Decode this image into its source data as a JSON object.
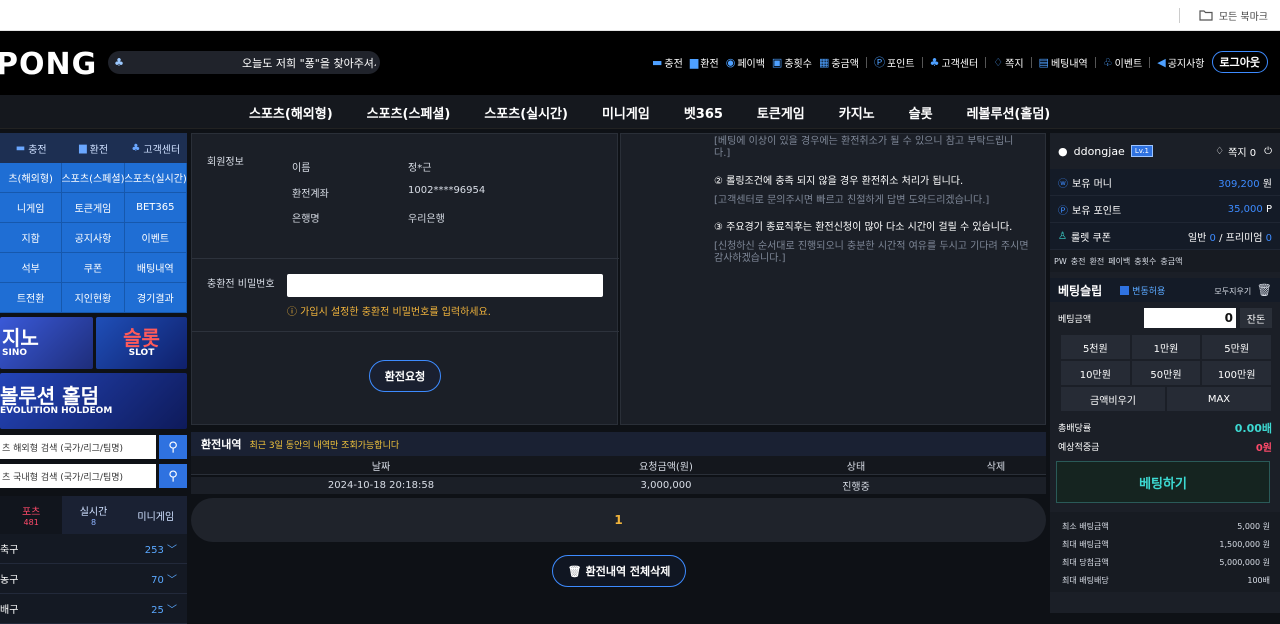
{
  "bookmarks": {
    "label": "모든 북마크"
  },
  "header": {
    "logo": "PONG",
    "ticker": "오늘도 저희 \"퐁\"을 찾아주셔서",
    "menu": [
      {
        "icon": "card-icon",
        "glyph": "▬",
        "label": "충전"
      },
      {
        "icon": "withdraw-icon",
        "glyph": "▆",
        "label": "환전"
      },
      {
        "icon": "payback-icon",
        "glyph": "◉",
        "label": "페이백"
      },
      {
        "icon": "count-icon",
        "glyph": "▣",
        "label": "충횟수"
      },
      {
        "icon": "money-icon",
        "glyph": "▦",
        "label": "충금액"
      },
      {
        "icon": "point-icon",
        "glyph": "Ⓟ",
        "label": "포인트"
      },
      {
        "icon": "support-icon",
        "glyph": "♣",
        "label": "고객센터"
      },
      {
        "icon": "message-icon",
        "glyph": "♢",
        "label": "쪽지"
      },
      {
        "icon": "history-icon",
        "glyph": "▤",
        "label": "베팅내역"
      },
      {
        "icon": "gift-icon",
        "glyph": "♧",
        "label": "이벤트"
      },
      {
        "icon": "megaphone-icon",
        "glyph": "◀",
        "label": "공지사항"
      }
    ],
    "logout": "로그아웃"
  },
  "nav": [
    "스포츠(해외형)",
    "스포츠(스페셜)",
    "스포츠(실시간)",
    "미니게임",
    "벳365",
    "토큰게임",
    "카지노",
    "슬롯",
    "레볼루션(홀덤)"
  ],
  "left": {
    "top_links": [
      "충전",
      "환전",
      "고객센터"
    ],
    "grid": [
      "츠(해외형)",
      "스포츠(스페셜)",
      "스포츠(실시간)",
      "니게임",
      "토큰게임",
      "BET365",
      "지함",
      "공지사항",
      "이벤트",
      "석부",
      "쿠폰",
      "배팅내역",
      "트전환",
      "지인현황",
      "경기결과"
    ],
    "banner_casino": {
      "big": "지노",
      "small": "SINO"
    },
    "banner_slot": {
      "big": "슬롯",
      "small": "SLOT"
    },
    "banner_holdem": {
      "big": "볼루션 홀덤",
      "small": "EVOLUTION HOLDEOM"
    },
    "search1": "츠 해외형 검색 (국가/리그/팀명)",
    "search2": "츠 국내형 검색 (국가/리그/팀명)",
    "tabs": [
      {
        "label": "포츠",
        "count": "481"
      },
      {
        "label": "실시간",
        "count": "8"
      },
      {
        "label": "미니게임",
        "count": ""
      }
    ],
    "sports": [
      {
        "name": "축구",
        "count": "253"
      },
      {
        "name": "농구",
        "count": "70"
      },
      {
        "name": "배구",
        "count": "25"
      }
    ]
  },
  "form": {
    "section_label": "회원정보",
    "rows": [
      {
        "label": "이름",
        "value": "정*근"
      },
      {
        "label": "환전계좌",
        "value": "1002****96954"
      },
      {
        "label": "은행명",
        "value": "우리은행"
      }
    ],
    "pw_label": "충환전 비밀번호",
    "pw_hint": "ⓘ 가입시 설정한 충환전 비밀번호를 입력하세요.",
    "submit": "환전요청"
  },
  "notice": {
    "lines": [
      {
        "t": "g",
        "text": "[베팅에 이상이 있을 경우에는 환전취소가 될 수 있으니 참고 부탁드립니다.]"
      },
      {
        "t": "w",
        "text": "② 롤링조건에 충족 되지 않을 경우 환전취소 처리가 됩니다."
      },
      {
        "t": "g",
        "text": "[고객센터로 문의주시면 빠르고 친절하게 답변 도와드리겠습니다.]"
      },
      {
        "t": "w",
        "text": "③ 주요경기 종료직후는 환전신청이 많아 다소 시간이 걸릴 수 있습니다."
      },
      {
        "t": "g",
        "text": "[신청하신 순서대로 진행되오니 충분한 시간적 여유를 두시고 기다려 주시면 감사하겠습니다.]"
      }
    ]
  },
  "history": {
    "title": "환전내역",
    "subtitle": "최근 3일 동안의 내역만 조회가능합니다",
    "columns": [
      "날짜",
      "요청금액(원)",
      "상태",
      "삭제"
    ],
    "rows": [
      {
        "date": "2024-10-18 20:18:58",
        "amount": "3,000,000",
        "status": "진행중",
        "del": ""
      }
    ],
    "page": "1",
    "delete_all": "환전내역 전체삭제"
  },
  "right": {
    "username": "ddongjae",
    "level": "Lv.1",
    "messages": "쪽지 0",
    "money_label": "보유 머니",
    "money_value": "309,200",
    "money_unit": "원",
    "point_label": "보유 포인트",
    "point_value": "35,000",
    "point_unit": "P",
    "coupon_label": "룰렛 쿠폰",
    "coupon_normal_label": "일반",
    "coupon_normal": "0",
    "coupon_premium_label": "/ 프리미엄",
    "coupon_premium": "0",
    "quick": [
      "PW",
      "충전",
      "환전",
      "페이백",
      "충횟수",
      "충금액"
    ],
    "slip_title": "베팅슬립",
    "odds_change": "변동허용",
    "clear_all": "모두지우기",
    "bet_amount_label": "베팅금액",
    "bet_amount": "0",
    "change": "잔돈",
    "chips": [
      "5천원",
      "1만원",
      "5만원",
      "10만원",
      "50만원",
      "100만원"
    ],
    "clear_amount": "금액비우기",
    "max": "MAX",
    "total_odds_label": "총배당률",
    "total_odds": "0.00배",
    "expected_label": "예상적중금",
    "expected": "0원",
    "bet_button": "베팅하기",
    "limits": [
      {
        "label": "최소 배팅금액",
        "value": "5,000 원"
      },
      {
        "label": "최대 배팅금액",
        "value": "1,500,000 원"
      },
      {
        "label": "최대 당첨금액",
        "value": "5,000,000 원"
      },
      {
        "label": "최대 배팅배당",
        "value": "100배"
      }
    ]
  },
  "colors": {
    "accent": "#3d8bff",
    "bg": "#0e1116",
    "panel": "#1b1f27",
    "highlight": "#f0b33c",
    "teal": "#3dd9d2"
  }
}
